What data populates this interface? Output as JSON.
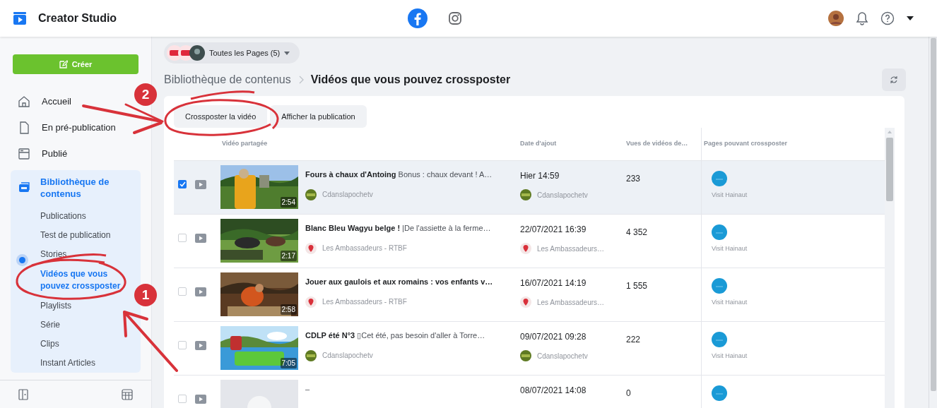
{
  "topbar": {
    "title": "Creator Studio",
    "platforms": [
      {
        "kind": "facebook",
        "selected": true
      },
      {
        "kind": "instagram",
        "selected": false
      }
    ]
  },
  "sidebar": {
    "create_button": "Créer",
    "items": [
      {
        "kind": "home",
        "label": "Accueil"
      },
      {
        "kind": "draft",
        "label": "En pré-publication"
      },
      {
        "kind": "published",
        "label": "Publié"
      }
    ],
    "library": {
      "label": "Bibliothèque de contenus",
      "children": [
        {
          "label": "Publications",
          "selected": false
        },
        {
          "label": "Test de publication",
          "selected": false
        },
        {
          "label": "Stories",
          "selected": false
        },
        {
          "label": "Vidéos que vous pouvez crossposter",
          "selected": true
        },
        {
          "label": "Playlists",
          "selected": false
        },
        {
          "label": "Série",
          "selected": false
        },
        {
          "label": "Clips",
          "selected": false
        },
        {
          "label": "Instant Articles",
          "selected": false
        }
      ]
    }
  },
  "main": {
    "pages_filter": "Toutes les Pages (5)",
    "breadcrumb": [
      "Bibliothèque de contenus",
      "Vidéos que vous pouvez crossposter"
    ],
    "actions": [
      "Crossposter la vidéo",
      "Afficher la publication"
    ],
    "table": {
      "columns": [
        "Vidéo partagée",
        "Date d'ajout",
        "Vues de vidéos de…",
        "Pages pouvant crossposter"
      ],
      "rows": [
        {
          "selected": true,
          "checked": true,
          "thumbnail": {
            "kind": "picture",
            "duration": "2:54"
          },
          "title": "**Fours à chaux d'Antoing** Bonus : chaux devant ! A…",
          "source": {
            "kind": "channel",
            "name": "Cdanslapochetv"
          },
          "date": "Hier 14:59",
          "date_source": {
            "kind": "channel",
            "name": "Cdanslapochetv"
          },
          "views": "233",
          "page": "Visit Hainaut"
        },
        {
          "selected": false,
          "checked": false,
          "thumbnail": {
            "kind": "picture",
            "duration": "2:17"
          },
          "title": "**Blanc Bleu Wagyu belge !** |De l'assiette à la ferme…",
          "source": {
            "kind": "pin",
            "name": "Les Ambassadeurs - RTBF"
          },
          "date": "22/07/2021 16:39",
          "date_source": {
            "kind": "pin",
            "name": "Les Ambassadeurs…"
          },
          "views": "4 352",
          "page": "Visit Hainaut"
        },
        {
          "selected": false,
          "checked": false,
          "thumbnail": {
            "kind": "picture",
            "duration": "2:58"
          },
          "title": "**Jouer aux gaulois et aux romains : vos enfants v…**",
          "source": {
            "kind": "pin",
            "name": "Les Ambassadeurs - RTBF"
          },
          "date": "16/07/2021 14:19",
          "date_source": {
            "kind": "pin",
            "name": "Les Ambassadeurs…"
          },
          "views": "1 555",
          "page": "Visit Hainaut"
        },
        {
          "selected": false,
          "checked": false,
          "thumbnail": {
            "kind": "picture",
            "duration": "7:05"
          },
          "title": "**CDLP été N°3** ▯Cet été, pas besoin d'aller à Torre…",
          "source": {
            "kind": "channel",
            "name": "Cdanslapochetv"
          },
          "date": "09/07/2021 09:28",
          "date_source": {
            "kind": "channel",
            "name": "Cdanslapochetv"
          },
          "views": "222",
          "page": "Visit Hainaut"
        },
        {
          "selected": false,
          "checked": false,
          "thumbnail": {
            "kind": "placeholder"
          },
          "title": "–",
          "date": "08/07/2021 14:08",
          "views": "0"
        }
      ]
    }
  },
  "annotations": [
    {
      "number": "2"
    },
    {
      "number": "1"
    }
  ]
}
